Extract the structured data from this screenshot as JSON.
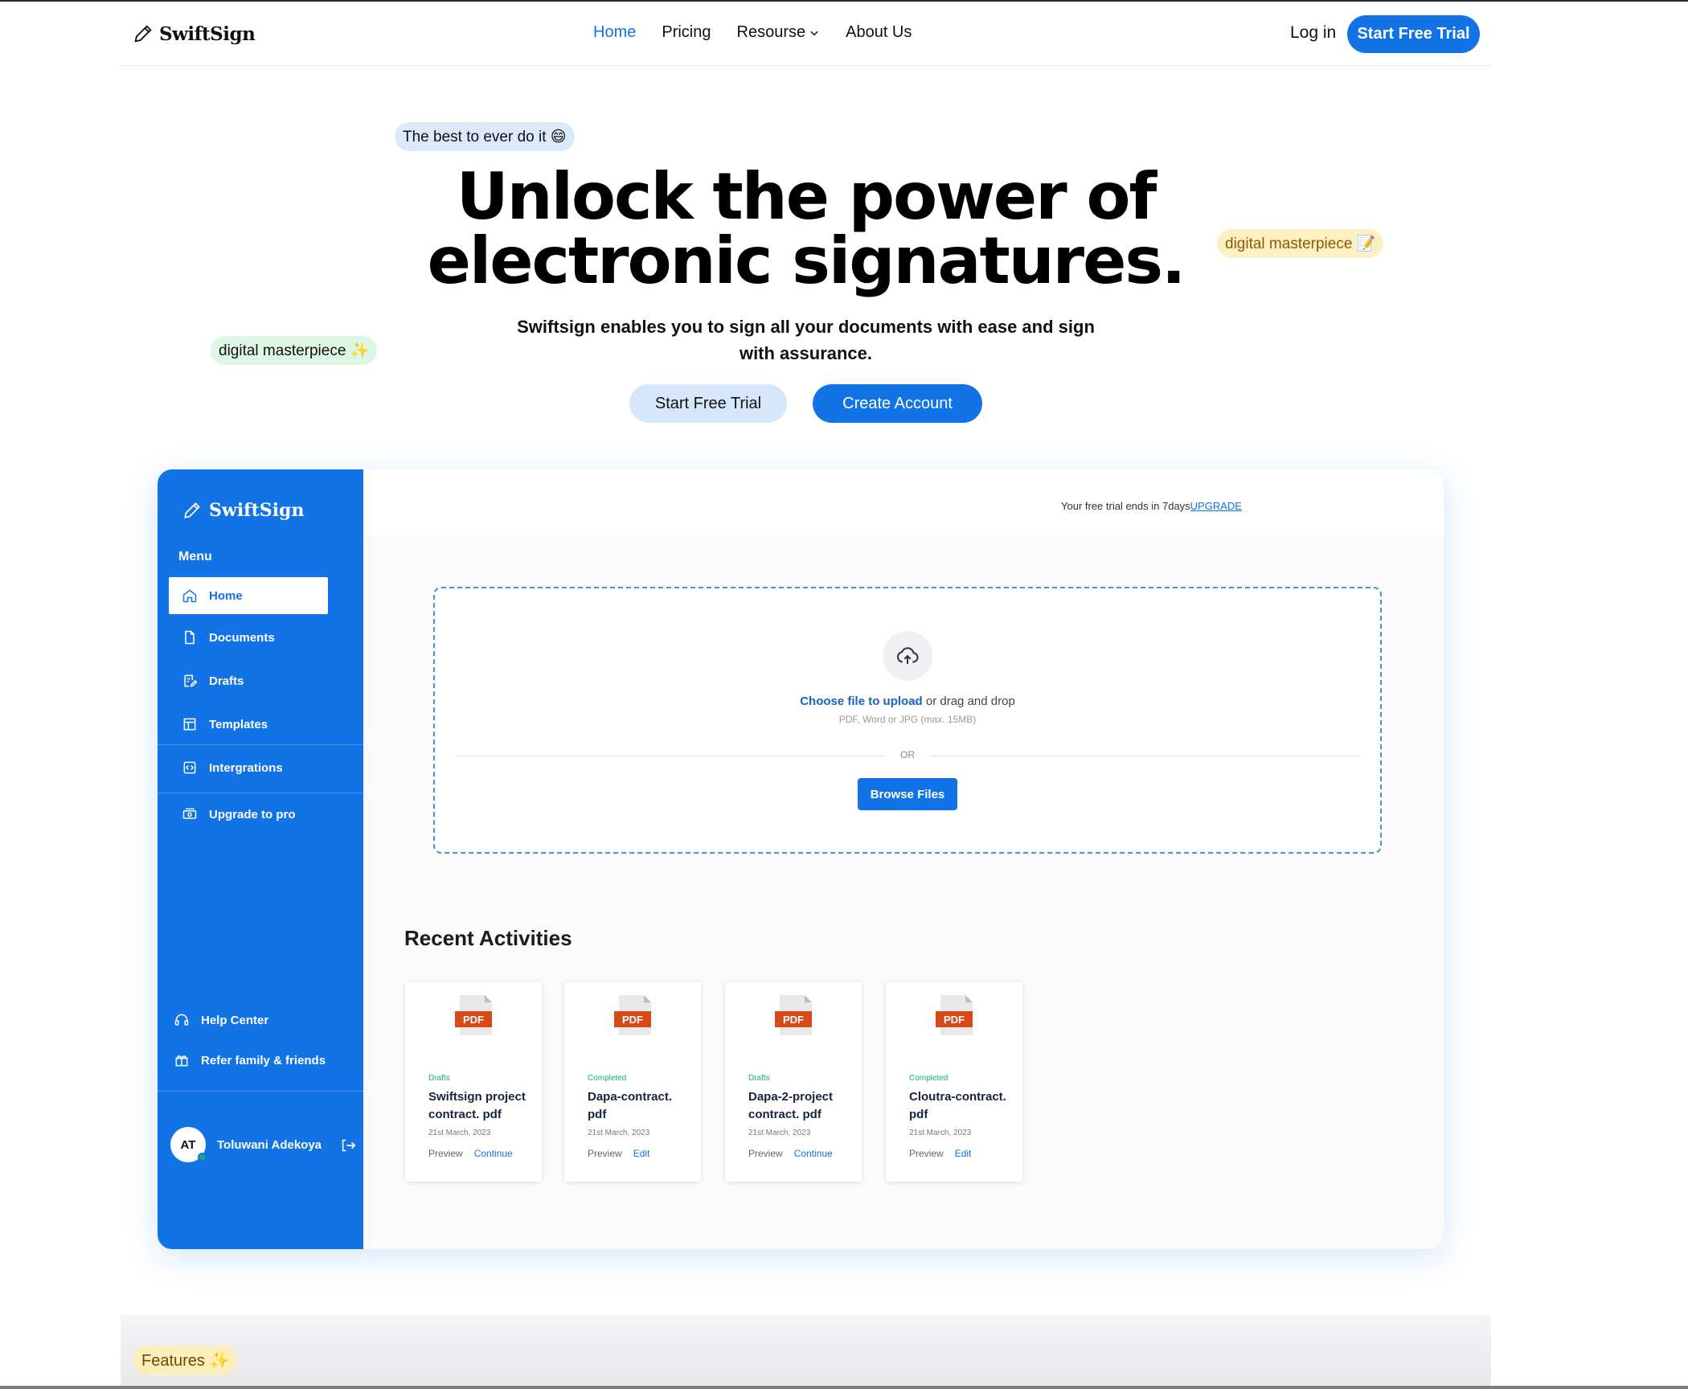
{
  "nav": {
    "brand": "SwiftSign",
    "links": [
      "Home",
      "Pricing",
      "Resourse",
      "About Us"
    ],
    "login": "Log in",
    "cta": "Start Free Trial"
  },
  "hero": {
    "badge": "The best to ever do it 😄",
    "float_tag_1": "digital masterpiece 📝",
    "float_tag_2": "digital masterpiece ✨",
    "title_line1": "Unlock the power of",
    "title_line2": "electronic signatures.",
    "subtitle": "Swiftsign enables you to sign all your documents with ease and sign with assurance.",
    "btn_trial": "Start Free Trial",
    "btn_create": "Create Account"
  },
  "app": {
    "brand": "SwiftSign",
    "menu_label": "Menu",
    "sidebar_items": [
      "Home",
      "Documents",
      "Drafts",
      "Templates",
      "Intergrations",
      "Upgrade to pro"
    ],
    "help_items": [
      "Help Center",
      "Refer family & friends"
    ],
    "user": {
      "initials": "AT",
      "name": "Toluwani Adekoya"
    },
    "trial_notice": "Your free trial ends in 7days",
    "upgrade_link": "UPGRADE",
    "upload": {
      "choose": "Choose file to upload",
      "drag": " or drag and drop",
      "hint": "PDF, Word or JPG (max. 15MB)",
      "or": "OR",
      "browse": "Browse Files"
    },
    "recent_title": "Recent Activities",
    "cards": [
      {
        "status": "Drafts",
        "name": "Swiftsign project contract. pdf",
        "date": "21st March, 2023",
        "preview": "Preview",
        "action": "Continue"
      },
      {
        "status": "Completed",
        "name": "Dapa-contract. pdf",
        "date": "21st March, 2023",
        "preview": "Preview",
        "action": "Edit"
      },
      {
        "status": "Drafts",
        "name": "Dapa-2-project contract. pdf",
        "date": "21st March, 2023",
        "preview": "Preview",
        "action": "Continue"
      },
      {
        "status": "Completed",
        "name": "Cloutra-contract. pdf",
        "date": "21st March, 2023",
        "preview": "Preview",
        "action": "Edit"
      }
    ],
    "pdf_label": "PDF"
  },
  "features": {
    "badge": "Features ✨"
  },
  "colors": {
    "primary": "#1273e6",
    "success": "#19b35c",
    "pdf_tag": "#d64a1a"
  }
}
